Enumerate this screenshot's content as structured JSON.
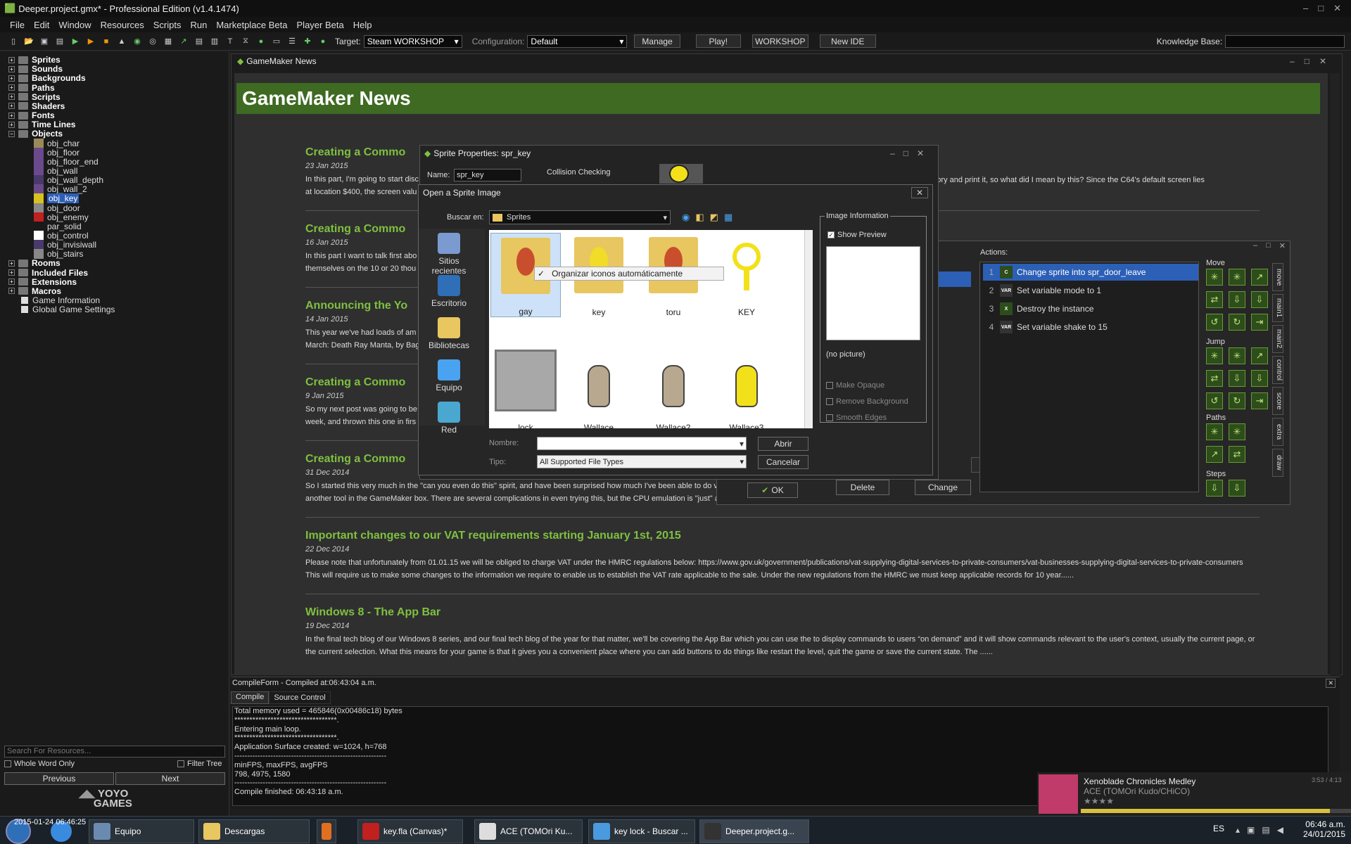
{
  "window": {
    "title": "Deeper.project.gmx*  -  Professional Edition (v1.4.1474)"
  },
  "menu": [
    "File",
    "Edit",
    "Window",
    "Resources",
    "Scripts",
    "Run",
    "Marketplace Beta",
    "Player Beta",
    "Help"
  ],
  "toolbar": {
    "target_label": "Target:",
    "target_value": "Steam WORKSHOP",
    "config_label": "Configuration:",
    "config_value": "Default",
    "manage": "Manage",
    "play": "Play!",
    "workshop": "WORKSHOP",
    "new_ide": "New IDE",
    "kb_label": "Knowledge Base:"
  },
  "tree": {
    "folders": [
      "Sprites",
      "Sounds",
      "Backgrounds",
      "Paths",
      "Scripts",
      "Shaders",
      "Fonts",
      "Time Lines",
      "Objects"
    ],
    "objects": [
      "obj_char",
      "obj_floor",
      "obj_floor_end",
      "obj_wall",
      "obj_wall_depth",
      "obj_wall_2",
      "obj_key",
      "obj_door",
      "obj_enemy",
      "par_solid",
      "obj_control",
      "obj_invisiwall",
      "obj_stairs"
    ],
    "after": [
      "Rooms",
      "Included Files",
      "Extensions",
      "Macros",
      "Game Information",
      "Global Game Settings"
    ],
    "search_placeholder": "Search For Resources...",
    "whole_word": "Whole Word Only",
    "filter_tree": "Filter Tree",
    "previous": "Previous",
    "next": "Next"
  },
  "news": {
    "tab": "GameMaker News",
    "heading": "GameMaker News",
    "posts": [
      {
        "title": "Creating a Commo",
        "date": "23 Jan 2015",
        "l1": "In this part, I'm going to start disc",
        "l1r": "4's screen memory and print it, so what did I mean by this? Since the C64's default screen lies",
        "l2": "at location $400, the screen valu"
      },
      {
        "title": "Creating a Commo",
        "date": "16 Jan 2015",
        "l1": "In this part I want to talk first abo",
        "l2": "themselves on the 10 or 20 thou"
      },
      {
        "title": "Announcing the Yo",
        "date": "14 Jan 2015",
        "l1": "This year we've had loads of am",
        "l2": "March: Death Ray Manta, by Bag"
      },
      {
        "title": "Creating a Commo",
        "date": "9 Jan 2015",
        "l1": "So my next post was going to be",
        "l2": "week, and thrown this one in firs"
      },
      {
        "title": "Creating a Commo",
        "date": "31 Dec 2014",
        "l1": "So I started this very much in the \"can you even do this\" spirit, and have been surprised how much I've been able to do v",
        "l2": "another tool in the GameMaker box. There are several complications in even trying this, but the CPU emulation is \"just\" a p"
      },
      {
        "title": "Important changes to our VAT requirements starting January 1st, 2015",
        "date": "22 Dec 2014",
        "l1": "Please note that unfortunately from 01.01.15 we will be obliged to charge VAT under the HMRC regulations below: https://www.gov.uk/government/publications/vat-supplying-digital-services-to-private-consumers/vat-businesses-supplying-digital-services-to-private-consumers",
        "l2": "This will require us to make some changes to the information we require to enable us to establish the VAT rate applicable to the sale.  Under the new regulations from the HMRC we must keep applicable records for 10 year......"
      },
      {
        "title": "Windows 8 - The App Bar",
        "date": "19 Dec 2014",
        "l1": "In the final tech blog of our Windows 8 series, and our final tech blog of the year for that matter, we'll be covering the App Bar which you can use the to display commands to users “on demand” and it will show commands relevant to the user's context, usually the current page, or",
        "l2": "the current selection. What this means for your game is that it gives you a convenient place where you can add buttons to do things like restart the level, quit the game or save the current state. The ......"
      }
    ]
  },
  "compile": {
    "header": "CompileForm - Compiled at:06:43:04 a.m.",
    "tab_compile": "Compile",
    "tab_source": "Source Control",
    "lines": [
      "Total memory used = 465846(0x00486c18) bytes",
      "**********************************.",
      "Entering main loop.",
      "**********************************.",
      "Application Surface created: w=1024, h=768",
      "-----------------------------------------------------------",
      "minFPS, maxFPS, avgFPS",
      "798, 4975, 1580",
      "-----------------------------------------------------------",
      "Compile finished: 06:43:18 a.m."
    ]
  },
  "sprite_props": {
    "title": "Sprite Properties: spr_key",
    "name_label": "Name:",
    "name_value": "spr_key",
    "collision": "Collision Checking"
  },
  "open_dialog": {
    "title": "Open a Sprite Image",
    "look_in_label": "Buscar en:",
    "look_in_value": "Sprites",
    "places": [
      "Sitios recientes",
      "Escritorio",
      "Bibliotecas",
      "Equipo",
      "Red"
    ],
    "items": [
      "gay",
      "key",
      "toru",
      "KEY",
      "lock",
      "Wallace",
      "Wallace2",
      "Wallace3"
    ],
    "tooltip": "Organizar iconos automáticamente",
    "name_label": "Nombre:",
    "type_label": "Tipo:",
    "type_value": "All Supported File Types",
    "open": "Abrir",
    "cancel": "Cancelar",
    "image_info": "Image Information",
    "show_preview": "Show Preview",
    "no_picture": "(no picture)",
    "make_opaque": "Make Opaque",
    "remove_bg": "Remove Background",
    "smooth_edges": "Smooth Edges"
  },
  "object_props": {
    "actions_label": "Actions:",
    "actions": [
      {
        "n": "1",
        "text": "Change sprite into spr_door_leave",
        "icon": "C"
      },
      {
        "n": "2",
        "text": "Set variable mode to 1",
        "icon": "VAR"
      },
      {
        "n": "3",
        "text": "Destroy the instance",
        "icon": "X"
      },
      {
        "n": "4",
        "text": "Set variable shake to 15",
        "icon": "VAR"
      }
    ],
    "groups": [
      "Move",
      "Jump",
      "Paths",
      "Steps"
    ],
    "tabs": [
      "move",
      "main1",
      "main2",
      "control",
      "score",
      "extra",
      "draw"
    ],
    "ok": "OK",
    "delete": "Delete",
    "change": "Change"
  },
  "music": {
    "title": "Xenoblade Chronicles Medley",
    "artist": "ACE (TOMOri Kudo/CHiCO)",
    "time": "3:53 / 4:13",
    "rating": "★★★★"
  },
  "taskbar": {
    "items": [
      "Equipo",
      "Descargas",
      "",
      "key.fla (Canvas)*",
      "ACE (TOMOri Ku...",
      "key lock - Buscar ...",
      "Deeper.project.g..."
    ],
    "lang": "ES",
    "time": "06:46 a.m.",
    "date": "24/01/2015",
    "overlay": "2015-01-24 06:46:25"
  }
}
